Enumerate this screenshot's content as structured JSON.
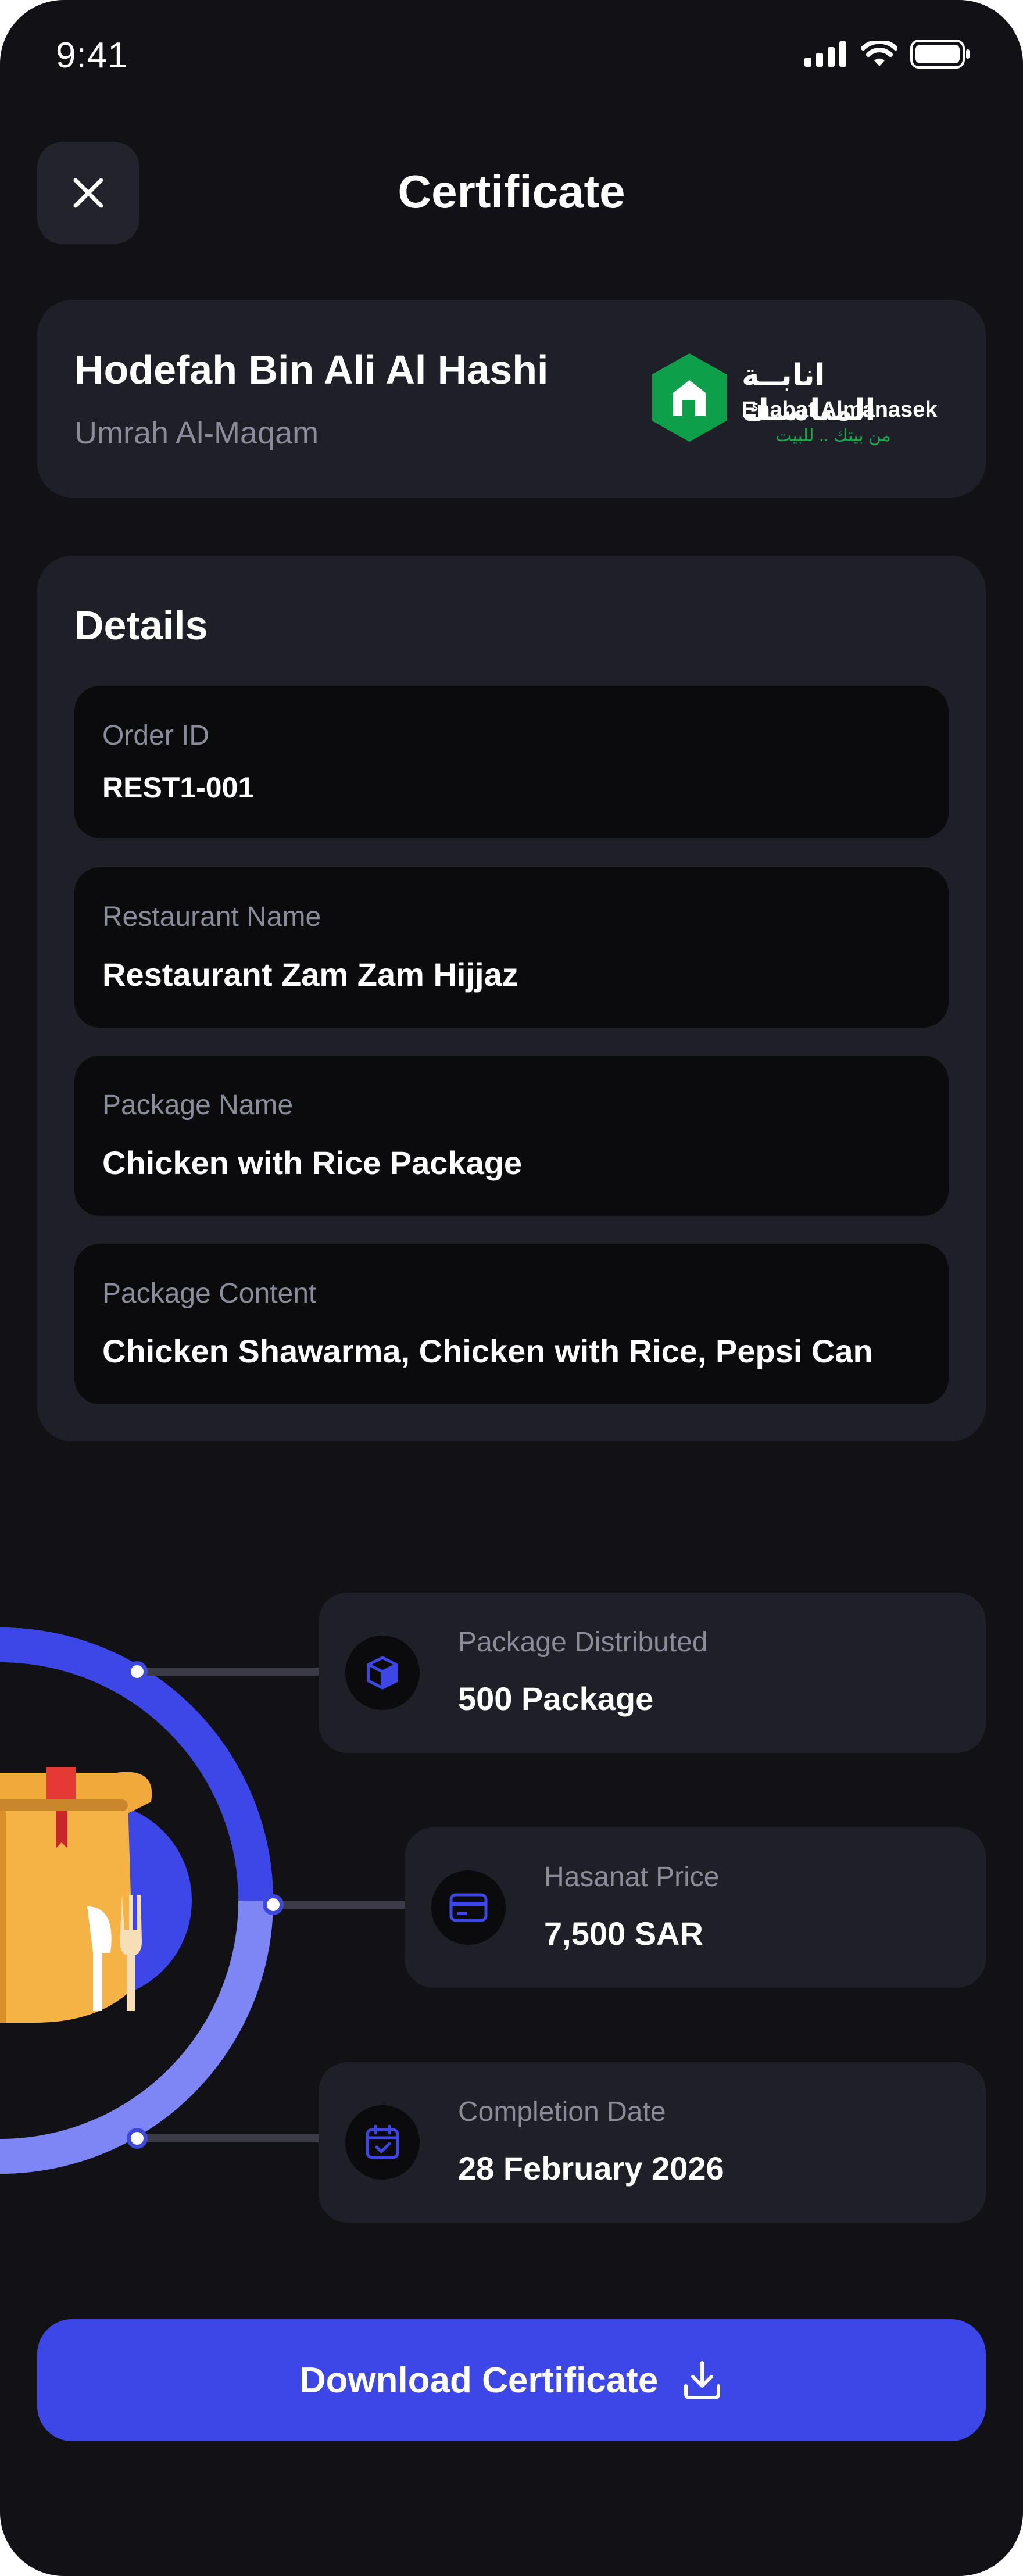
{
  "status_bar": {
    "time": "9:41"
  },
  "header": {
    "title": "Certificate"
  },
  "profile": {
    "name": "Hodefah Bin Ali Al Hashi",
    "subtitle": "Umrah Al-Maqam",
    "brand": {
      "arabic": "انابــة المناسـك",
      "english": "Enabat Almanasek",
      "tagline": "من بيتك .. للبيت"
    }
  },
  "details": {
    "title": "Details",
    "fields": [
      {
        "label": "Order ID",
        "value": "REST1-001"
      },
      {
        "label": "Restaurant Name",
        "value": "Restaurant Zam Zam Hijjaz"
      },
      {
        "label": "Package Name",
        "value": "Chicken with Rice Package"
      },
      {
        "label": "Package Content",
        "value": "Chicken Shawarma, Chicken with Rice, Pepsi Can"
      }
    ]
  },
  "stats": [
    {
      "icon": "box-icon",
      "label": "Package Distributed",
      "value": "500 Package"
    },
    {
      "icon": "card-icon",
      "label": "Hasanat Price",
      "value": "7,500 SAR"
    },
    {
      "icon": "calendar-check-icon",
      "label": "Completion Date",
      "value": "28 February 2026"
    }
  ],
  "actions": {
    "download_label": "Download Certificate"
  },
  "colors": {
    "accent": "#3d46e6",
    "brand_green": "#0e9f4a",
    "background": "#111116",
    "card": "#1e1f27"
  }
}
